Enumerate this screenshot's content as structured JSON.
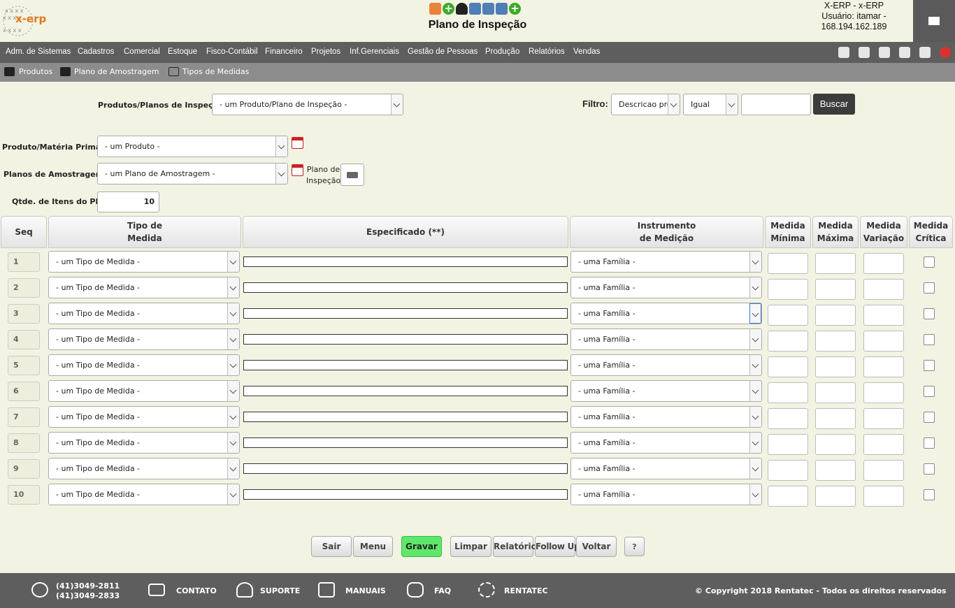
{
  "header": {
    "logo_text": "x-erp",
    "title": "Plano de Inspeção",
    "user_line1": "X-ERP - x-ERP",
    "user_line2": "Usuário: itamar -",
    "user_line3": "168.194.162.189"
  },
  "menu": [
    "Adm. de Sistemas",
    "Cadastros",
    "Comercial",
    "Estoque",
    "Fisco-Contábil",
    "Financeiro",
    "Projetos",
    "Inf.Gerenciais",
    "Gestão de Pessoas",
    "Produção",
    "Relatórios",
    "Vendas"
  ],
  "submenu": [
    "Produtos",
    "Plano de Amostragem",
    "Tipos de Medidas"
  ],
  "filter": {
    "produtos_label": "Produtos/Planos de Inspeção",
    "produtos_value": "- um Produto/Plano de Inspeção -",
    "filtro_label": "Filtro:",
    "campo_value": "Descricao pro",
    "operador_value": "Igual",
    "busca_value": "",
    "buscar_label": "Buscar"
  },
  "form": {
    "produto_label": "Produto/Matéria Prima",
    "produto_value": "- um Produto -",
    "planos_label": "Planos de Amostragem",
    "planos_value": "- um Plano de Amostragem -",
    "plano_inspecao_label_1": "Plano de",
    "plano_inspecao_label_2": "Inspeção",
    "qtde_label": "Qtde. de Itens do Plano",
    "qtde_value": "10"
  },
  "table": {
    "headers": {
      "seq": "Seq",
      "tipo_1": "Tipo de",
      "tipo_2": "Medida",
      "especificado": "Especificado (**)",
      "instr_1": "Instrumento",
      "instr_2": "de Medição",
      "min_1": "Medida",
      "min_2": "Mínima",
      "max_1": "Medida",
      "max_2": "Máxima",
      "var_1": "Medida",
      "var_2": "Variação",
      "crit_1": "Medida",
      "crit_2": "Crítica"
    },
    "rows": [
      {
        "seq": "1",
        "tipo": "- um Tipo de Medida -",
        "instrumento": "- uma Família -"
      },
      {
        "seq": "2",
        "tipo": "- um Tipo de Medida -",
        "instrumento": "- uma Família -"
      },
      {
        "seq": "3",
        "tipo": "- um Tipo de Medida -",
        "instrumento": "- uma Família -"
      },
      {
        "seq": "4",
        "tipo": "- um Tipo de Medida -",
        "instrumento": "- uma Família -"
      },
      {
        "seq": "5",
        "tipo": "- um Tipo de Medida -",
        "instrumento": "- uma Família -"
      },
      {
        "seq": "6",
        "tipo": "- um Tipo de Medida -",
        "instrumento": "- uma Família -"
      },
      {
        "seq": "7",
        "tipo": "- um Tipo de Medida -",
        "instrumento": "- uma Família -"
      },
      {
        "seq": "8",
        "tipo": "- um Tipo de Medida -",
        "instrumento": "- uma Família -"
      },
      {
        "seq": "9",
        "tipo": "- um Tipo de Medida -",
        "instrumento": "- uma Família -"
      },
      {
        "seq": "10",
        "tipo": "- um Tipo de Medida -",
        "instrumento": "- uma Família -"
      }
    ]
  },
  "buttons": {
    "sair": "Sair",
    "menu": "Menu",
    "gravar": "Gravar",
    "limpar": "Limpar",
    "relatorio": "Relatório",
    "followup": "Follow Up",
    "voltar": "Voltar",
    "help": "?"
  },
  "footer": {
    "phone1": "(41)3049-2811",
    "phone2": "(41)3049-2833",
    "contato": "CONTATO",
    "suporte": "SUPORTE",
    "manuais": "MANUAIS",
    "faq": "FAQ",
    "rentatec": "RENTATEC",
    "copyright": "© Copyright 2018 Rentatec - Todos os direitos reservados"
  },
  "colors": {
    "background": "#f3f3e3",
    "menubar": "#5e5e5e",
    "subbar": "#8c8c8c",
    "gravar": "#5ee86a",
    "buscar": "#3c3c3c"
  }
}
